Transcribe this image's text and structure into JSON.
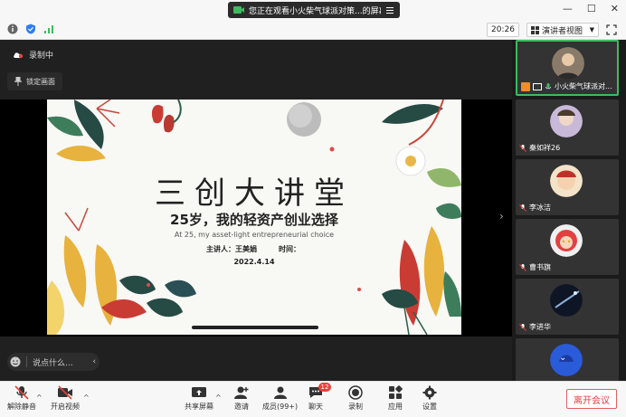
{
  "titlebar": {
    "share_text": "您正在观看小火柴气球派对策...的屏幕",
    "colors": {
      "pill": "#2b2b2b",
      "accent": "#3dbb5e"
    }
  },
  "toolbar": {
    "time": "20:26",
    "view_mode": "演讲者视图"
  },
  "main": {
    "recording_label": "录制中",
    "lock_label": "锁定画面",
    "chat_placeholder": "说点什么..."
  },
  "slide": {
    "title": "三创大讲堂",
    "subtitle": "25岁，我的轻资产创业选择",
    "english": "At 25, my asset-light entrepreneurial choice",
    "presenter": "主讲人：王美娟",
    "time_label": "时间：",
    "date": "2022.4.14"
  },
  "participants": [
    {
      "name": "小火柴气球派对...",
      "active": true
    },
    {
      "name": "秦如祥26",
      "active": false
    },
    {
      "name": "李冰洁",
      "active": false
    },
    {
      "name": "曹书旗",
      "active": false
    },
    {
      "name": "李进华",
      "active": false
    },
    {
      "name": "",
      "active": false
    }
  ],
  "bottombar": {
    "unmute": "解除静音",
    "start_video": "开启视频",
    "share_screen": "共享屏幕",
    "invite": "邀请",
    "members": "成员(99+)",
    "chat": "聊天",
    "chat_badge": "12",
    "record": "录制",
    "apps": "应用",
    "settings": "设置",
    "leave": "离开会议"
  }
}
